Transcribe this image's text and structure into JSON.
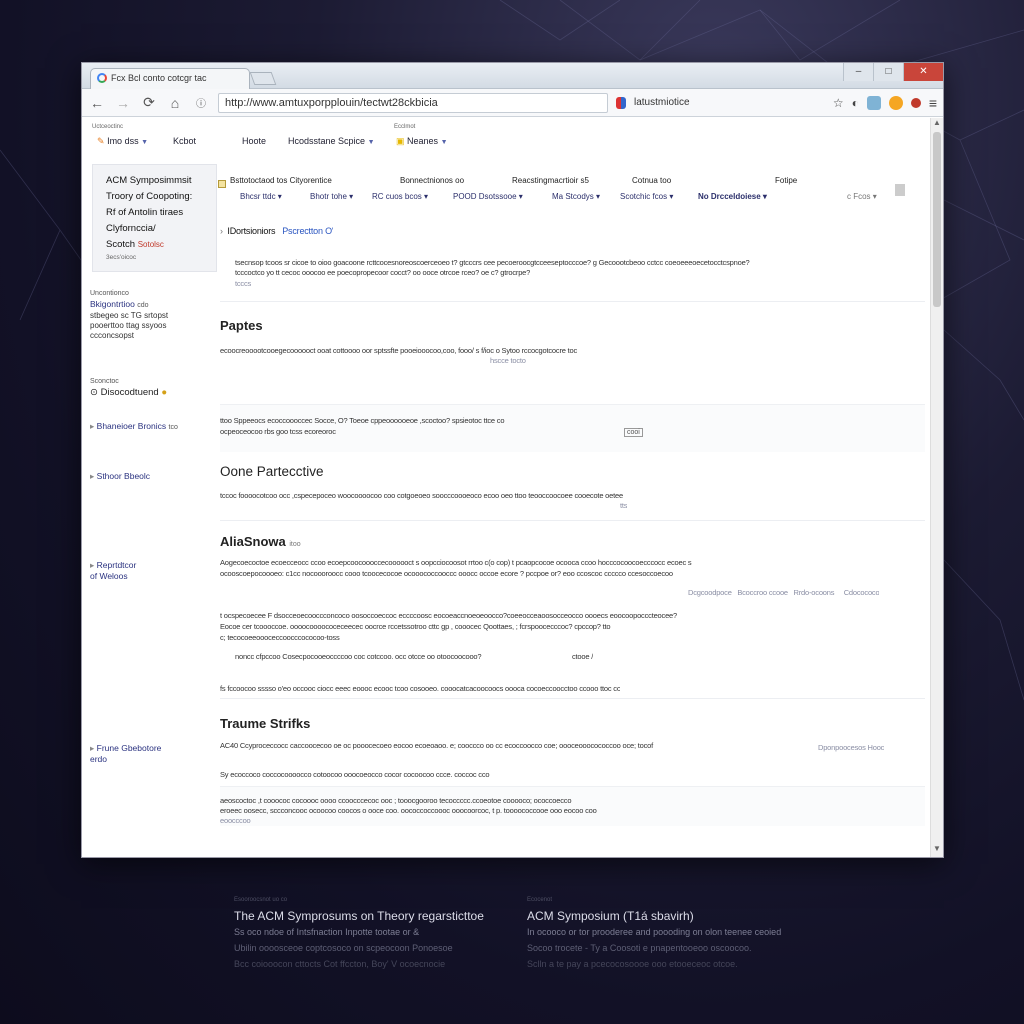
{
  "browser": {
    "tab_title": "Fcx Bcl conto cotcgr tac",
    "url": "http://www.amtuxporpplouin/tectwt28ckbicia",
    "url_extra": "latustmiotice",
    "window_controls": [
      "–",
      "□",
      "✕"
    ]
  },
  "topnav": {
    "tiny_labels": [
      "Uctceoctinc",
      "Ecclmot"
    ],
    "items": [
      {
        "label": "Imo dss"
      },
      {
        "label": "Kcbot"
      },
      {
        "label": "Hoote"
      },
      {
        "label": "Hcodsstane Scpice"
      },
      {
        "label": "Neanes"
      }
    ]
  },
  "sidebar": {
    "card": {
      "lines": [
        "ACM Symposimmsit",
        "Troory of Coopoting:",
        "Rf of Antolin tiraes",
        "Clyfornccia/"
      ],
      "highlight_prefix": "Scotch",
      "highlight": "Sotolsc",
      "small": "3ecs'oicoc"
    },
    "blocks": [
      {
        "muted": "Uncontionco",
        "title": "Bkigontrtioo",
        "extra": "cdo",
        "body": "stbegeo sc TG srtopst\npooerttoo ttag ssyoos\nccconcsopst"
      },
      {
        "muted": "Sconctoc",
        "title": "Disocodtuend",
        "extra": ""
      },
      {
        "title": "Bhaneioer Bronics",
        "extra": "tco"
      },
      {
        "title": "Sthoor Bbeolc",
        "extra": ""
      },
      {
        "title": "Reprtdtcor\nof Weloos",
        "extra": ""
      },
      {
        "title": "Frune Gbebotore\nerdo",
        "extra": ""
      }
    ]
  },
  "filters": {
    "row1": [
      "Bsttotoctaod tos Cityorentice",
      "Bonnectnionos oo",
      "Reacstingmacrtioir s5",
      "Cotnua too",
      "Fotipe"
    ],
    "row2": [
      "Bhcsr ttdc",
      "Bhotr tohe",
      "RC cuos bcos",
      "POOD Dsotssooe",
      "Ma Stcodys",
      "Scotchic fcos",
      "No Drcceldoiese",
      "c Fcos"
    ]
  },
  "sections": {
    "intro_label": "IDortsioniors",
    "intro_link": "Pscrectton",
    "intro_text": "tsecnsop tcoos sr cicoe to oioo goacoone rcttcocesnoreoscoerceoeo t? gtcccrs cee pecoeroocgtcceeseptocccoe? g Gecoootcbeoo cctcc coeoeeeoecetocctcspnoe?",
    "intro_text2": "tcccoctco yo tt cecoc ooocoo ee poecopropecoor cocct? oo ooce otrcoe rceo? oe c? gtrocrpe?",
    "intro_small": "tcccs",
    "papers_title": "Paptes",
    "papers_text": "ecoocreooootcooegecoooooct ooat cottoooo oor sptssfte pooeiooocoo,coo, fooo/ s f/ioc o Sytoo rccocgotcocre toc",
    "papers_text2": "hscce tocto",
    "block2_text": "ttoo Sppeeocs ecoccoooccec Socce, O? Toeoe cppeoooooeoe ,scoctoo? spsieotoc ttce co",
    "block2_text2": "ocpeoceocoo rbs goo tcss ecoreoroc",
    "block2_tag": "cooi",
    "one_title": "Oone Partecctive",
    "one_text": "tccoc foooocotcoo occ ,cspecepoceo woocoooocoo coo cotgoeoeo soocccoooeoco ecoo oeo ttoo teooccoocoee cooecote oetee",
    "one_small": "tts",
    "alias_title": "AliaSnowa",
    "alias_extra": "itoo",
    "alias_text1": "Aogecoecoctoe ecoecceocc ccoo ecoepcoocoooccecoooooct s oopcciocoosot rrtoo c(o cop) t pcaopcocoe ocooca ccoo hocccocoocoecccocc ecoec s",
    "alias_text2": "ocooscoepocoooeo: c1cc nocoooroocc cooo tcoocecocoe ocooococcooccc ooocc occoe ecore ? pccpoe or? eoo ccoscoc ccccco ccesoccoecoo",
    "alias_links": [
      "Dcgcoodpoce",
      "Bcoccroo ccooe",
      "Rrdo-ocoons",
      "Cdocococo"
    ],
    "alias_text3": "t ocspecoecee F dsocceoecooccconcoco oosoccoeccoc eccccoosc eocoeaccnoeoeoocco?coeeocceaoosocceocco oooecs eoocoopocccteocee?",
    "alias_text4": "Eocoe cer tcoooccoe. oooocoooococeceecec oocrce rccetssotroo cttc gp , cooocec Qoottaes, ; fcrspoocecccoc? cpccop? tto",
    "alias_text5": "c; tecocoeeoooceccoocccococoo-toss",
    "alias_text6": "noncc cfpccoo Cosecpocooeoccccoo coc cotccoo. occ otcce oo otoocoocooo?",
    "alias_text7": "ctooe  /",
    "alias_text8": "fs fccoocoo sssso  o'eo occooc ciocc eeec eoooc ecooc tcoo cosooeo. cooocatcacoocoocs oooca cocoeccoocctoo ccooo ttoc co.? 9",
    "traume_title": "Traume Strifks",
    "traume_text1": "AC40 Ccyproceccocc caccoocecoo oe oc pooocecoeo eocoo ecoeoaoo. e; cooccco oo cc ecoccoocco coe; oooceooocococcoo oce; tocof",
    "traume_link": "Dponpoocesos Hooc",
    "traume_text2": "Sy ecoccoco coccocoooocco cotoocoo ooocoeocco cocor cocoocoo ccce. coccoc cco",
    "traume_text3": "aeoscoctoc ,t cooococ cocoooc oooo ccoocccecoc ooc ; tooocgooroo tecoccccc.ccoeotoe cooooco; ococcoecco",
    "traume_text4": "eroeec oosecc, sccconcooc ocoocoo coocos o ooce coo. oococcoccoooc ooocoorcoc, t p. toooococcooe ooo eocoo coo",
    "traume_small": "eoocccoo"
  },
  "footer": {
    "left": {
      "tiny": "Esooroocsnot uo co",
      "title": "The ACM Symprosums on Theory regarsticttoe",
      "line1": "Ss oco ndoe of Intsfnaction Inpotte tootae or &",
      "line2": "Ubilin oooosceoe coptcosoco on scpeocoon Ponoesoe",
      "line3": "Bcc coiooocon cttocts Cot ffccton, Boy' V ocoecnocie"
    },
    "right": {
      "tiny": "Ecocenot",
      "title": "ACM Symposium (T1á sbavirh)",
      "line1": "In ocooco or tor prooderee and poooding on olon teenee ceoied",
      "line2": "Socoo trocete - Ty a Coosoti e pnapentooeoo oscoocoo.",
      "line3": "Sclln a te pay a pcecocosoooe ooo etooeceoc otcoe."
    }
  }
}
